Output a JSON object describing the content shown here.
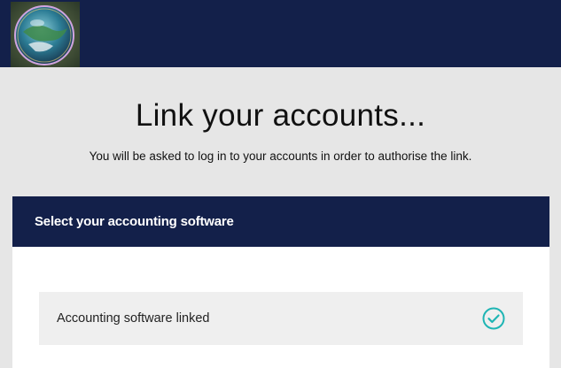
{
  "header": {
    "logo_icon": "globe-bubble-logo"
  },
  "hero": {
    "title": "Link your accounts...",
    "subtitle": "You will be asked to log in to your accounts in order to authorise the link."
  },
  "panel": {
    "title": "Select your accounting software",
    "linked_row": {
      "label": "Accounting software linked",
      "status_icon": "check-circle-icon"
    }
  },
  "colors": {
    "navy": "#13204a",
    "background": "#e6e6e6",
    "accent_teal": "#1fb5b4"
  }
}
